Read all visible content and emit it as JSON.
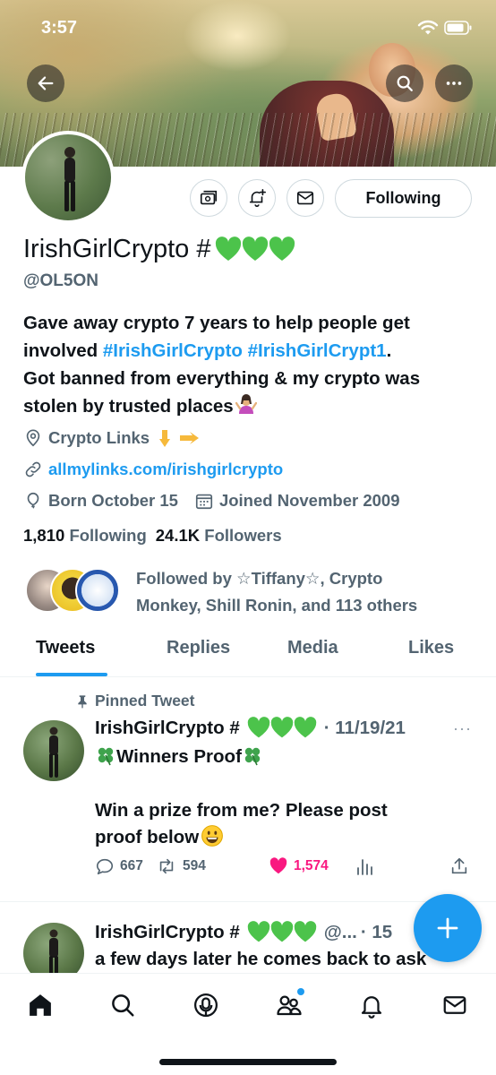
{
  "status": {
    "time": "3:57"
  },
  "profile": {
    "display_name": "IrishGirlCrypto #",
    "handle": "@OL5ON",
    "bio_line1": "Gave away crypto 7 years to help people get",
    "bio_line2_prefix": "involved ",
    "bio_hashtag1": "#IrishGirlCrypto",
    "bio_hashtag2": "#IrishGirlCrypt1",
    "bio_line2_suffix": ".",
    "bio_line3": "Got banned from everything & my crypto was",
    "bio_line4": "stolen by trusted places",
    "location": "Crypto Links",
    "website": "allmylinks.com/irishgirlcrypto",
    "birthday": "Born October 15",
    "joined": "Joined November 2009",
    "following_count": "1,810",
    "following_label": "Following",
    "followers_count": "24.1K",
    "followers_label": "Followers",
    "followed_by_line1": "Followed by ☆Tiffany☆, Crypto",
    "followed_by_line2": "Monkey, Shill Ronin, and 113 others",
    "following_button": "Following"
  },
  "tabs": [
    "Tweets",
    "Replies",
    "Media",
    "Likes"
  ],
  "tweet1": {
    "pinned_label": "Pinned Tweet",
    "author": "IrishGirlCrypto #",
    "date": "· 11/19/21",
    "more": "···",
    "title": "Winners Proof",
    "body_line1": "Win a prize from me? Please post",
    "body_line2": "proof below",
    "replies": "667",
    "retweets": "594",
    "likes": "1,574"
  },
  "tweet2": {
    "author": "IrishGirlCrypto #",
    "handle_trunc": "@...",
    "date": "· 15",
    "body": "a few days later he comes back to ask"
  },
  "colors": {
    "accent": "#1d9bf0",
    "like": "#f91880",
    "text": "#0f1419",
    "muted": "#536471",
    "green_heart": "#4cc34b"
  }
}
